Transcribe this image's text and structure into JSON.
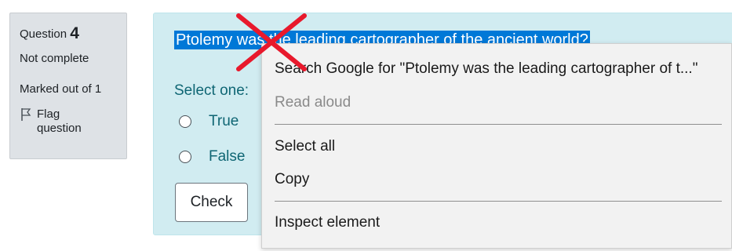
{
  "info": {
    "question_label": "Question",
    "question_number": "4",
    "status": "Not complete",
    "marks": "Marked out of 1",
    "flag_label": "Flag question"
  },
  "question": {
    "text": "Ptolemy was the leading cartographer of the ancient world?",
    "select_one": "Select one:",
    "options": [
      {
        "label": "True"
      },
      {
        "label": "False"
      }
    ],
    "check_label": "Check"
  },
  "context_menu": {
    "items": [
      {
        "label": "Search Google for \"Ptolemy was the leading cartographer of t...\"",
        "enabled": true
      },
      {
        "label": "Read aloud",
        "enabled": false
      },
      {
        "label": "Select all",
        "enabled": true
      },
      {
        "label": "Copy",
        "enabled": true
      },
      {
        "label": "Inspect element",
        "enabled": true
      }
    ]
  },
  "colors": {
    "selection": "#0078d7",
    "panel_bg": "#d1ecf1",
    "info_bg": "#dee2e6",
    "menu_bg": "#f2f2f2",
    "annotation_x": "#e8192c"
  }
}
